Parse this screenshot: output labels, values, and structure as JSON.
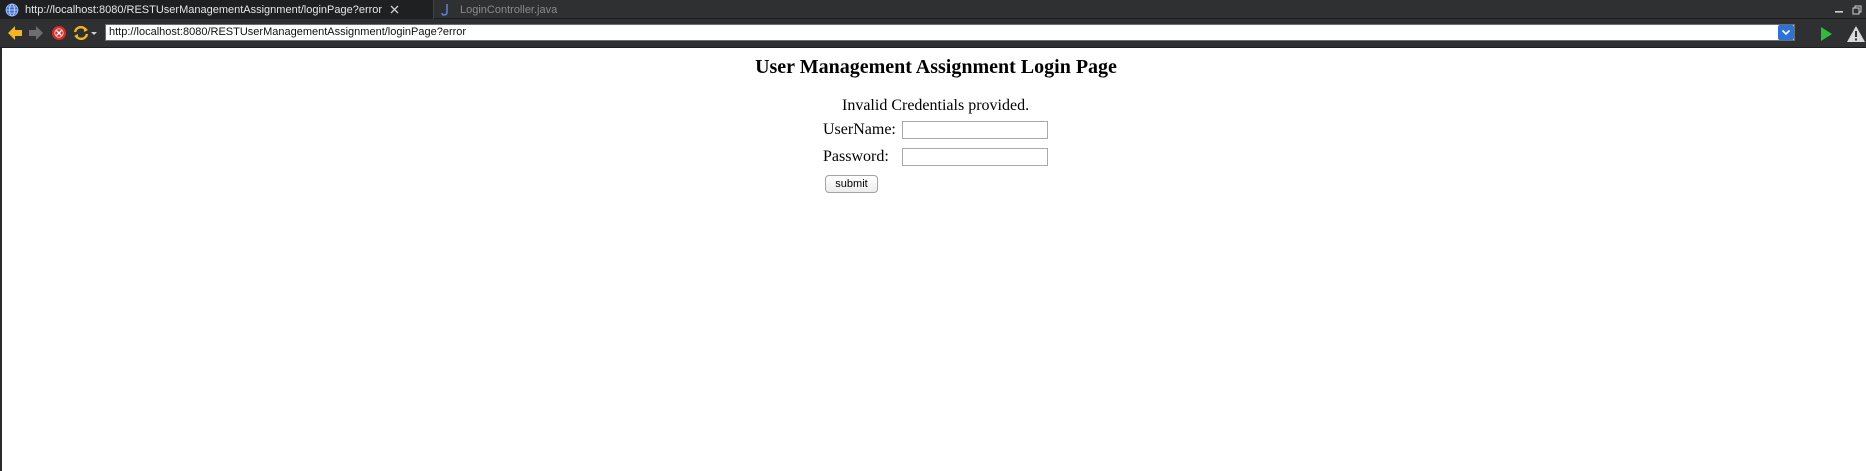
{
  "browser": {
    "tabs": [
      {
        "label": "http://localhost:8080/RESTUserManagementAssignment/loginPage?error",
        "icon": "globe-icon",
        "active": true
      },
      {
        "label": "LoginController.java",
        "icon": "java-file-icon",
        "active": false
      }
    ],
    "url": "http://localhost:8080/RESTUserManagementAssignment/loginPage?error",
    "accent_color": "#2d72d9"
  },
  "page": {
    "title": "User Management Assignment Login Page",
    "error_message": "Invalid Credentials provided.",
    "username_label": "UserName:",
    "password_label": "Password:",
    "username_value": "",
    "password_value": "",
    "submit_label": "submit"
  }
}
